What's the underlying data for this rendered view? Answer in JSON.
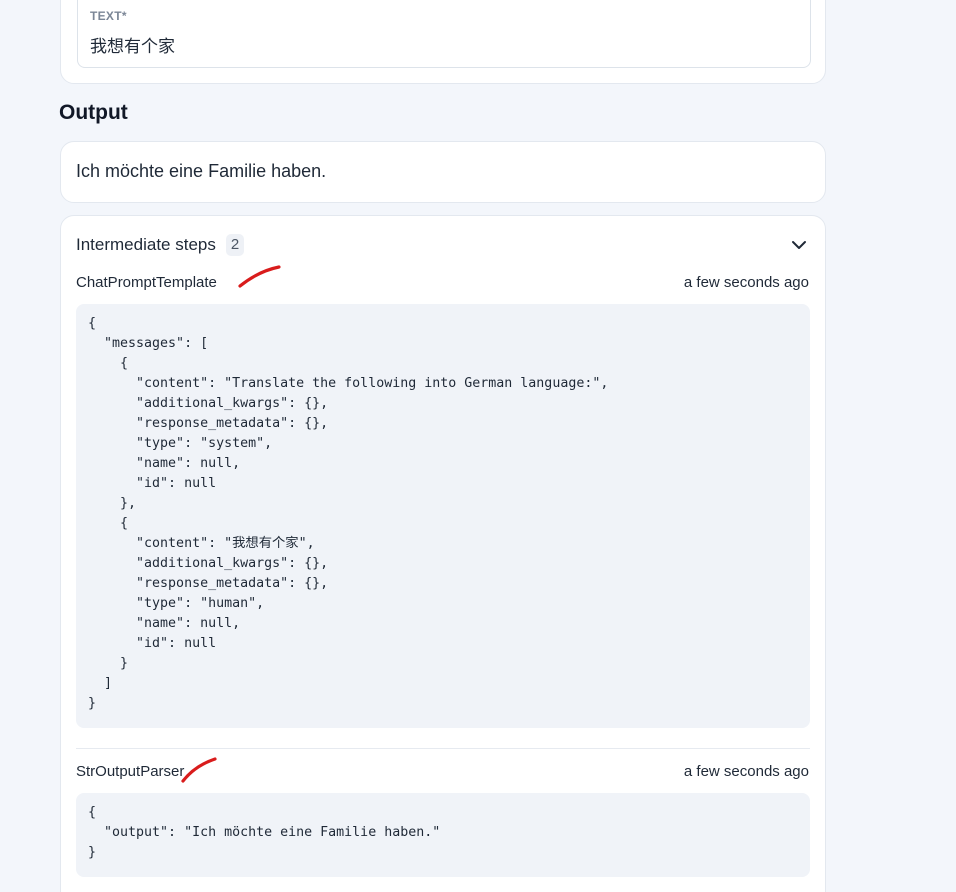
{
  "input": {
    "label": "TEXT*",
    "value": "我想有个家"
  },
  "output": {
    "heading": "Output",
    "text": "Ich möchte eine Familie haben."
  },
  "steps": {
    "title": "Intermediate steps",
    "count": "2",
    "items": [
      {
        "name": "ChatPromptTemplate",
        "time": "a few seconds ago",
        "code": "{\n  \"messages\": [\n    {\n      \"content\": \"Translate the following into German language:\",\n      \"additional_kwargs\": {},\n      \"response_metadata\": {},\n      \"type\": \"system\",\n      \"name\": null,\n      \"id\": null\n    },\n    {\n      \"content\": \"我想有个家\",\n      \"additional_kwargs\": {},\n      \"response_metadata\": {},\n      \"type\": \"human\",\n      \"name\": null,\n      \"id\": null\n    }\n  ]\n}"
      },
      {
        "name": "StrOutputParser",
        "time": "a few seconds ago",
        "code": "{\n  \"output\": \"Ich möchte eine Familie haben.\"\n}"
      }
    ]
  },
  "colors": {
    "background": "#f3f6fb",
    "card": "#ffffff",
    "code_bg": "#f0f3f8",
    "annotation": "#d91c1c"
  },
  "icons": {
    "collapse": "chevron-down-icon"
  }
}
